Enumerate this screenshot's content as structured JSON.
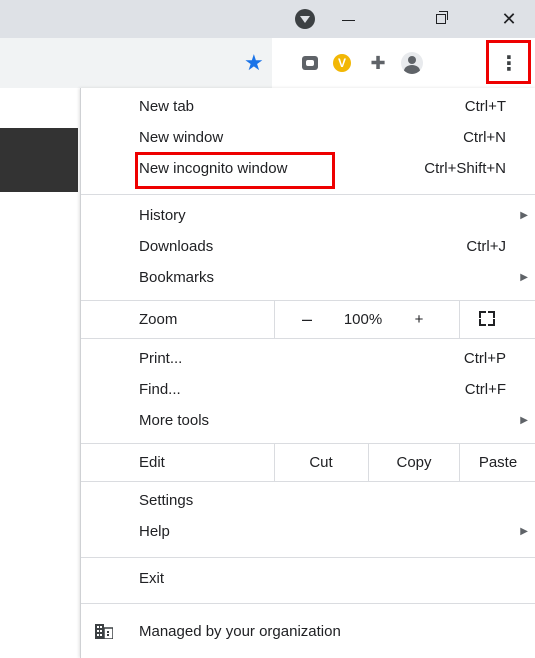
{
  "titlebar": {
    "icons": [
      "profile-menu-icon",
      "minimize-icon",
      "restore-icon",
      "close-icon"
    ],
    "close_glyph": "✕"
  },
  "toolbar": {
    "star_glyph": "★",
    "icons": [
      "bookmark-star-icon",
      "vpn-extension-icon",
      "v-extension-icon",
      "puzzle-extensions-icon",
      "profile-avatar-icon",
      "kebab-menu-icon"
    ],
    "kebab_glyph": "⋮",
    "puzzle_glyph": "✚",
    "v_glyph": "V"
  },
  "menu": {
    "new_tab": {
      "label": "New tab",
      "shortcut": "Ctrl+T"
    },
    "new_window": {
      "label": "New window",
      "shortcut": "Ctrl+N"
    },
    "new_incognito": {
      "label": "New incognito window",
      "shortcut": "Ctrl+Shift+N"
    },
    "history": {
      "label": "History",
      "arrow": "▶"
    },
    "downloads": {
      "label": "Downloads",
      "shortcut": "Ctrl+J"
    },
    "bookmarks": {
      "label": "Bookmarks",
      "arrow": "▶"
    },
    "zoom": {
      "label": "Zoom",
      "minus": "–",
      "level": "100%",
      "plus": "+"
    },
    "print": {
      "label": "Print...",
      "shortcut": "Ctrl+P"
    },
    "find": {
      "label": "Find...",
      "shortcut": "Ctrl+F"
    },
    "more_tools": {
      "label": "More tools",
      "arrow": "▶"
    },
    "edit": {
      "label": "Edit",
      "cut": "Cut",
      "copy": "Copy",
      "paste": "Paste"
    },
    "settings": {
      "label": "Settings"
    },
    "help": {
      "label": "Help",
      "arrow": "▶"
    },
    "exit": {
      "label": "Exit"
    },
    "managed": {
      "label": "Managed by your organization"
    }
  },
  "colors": {
    "highlight_box": "#ee0000",
    "star": "#1a73e8",
    "titlebar_bg": "#dee1e6"
  }
}
